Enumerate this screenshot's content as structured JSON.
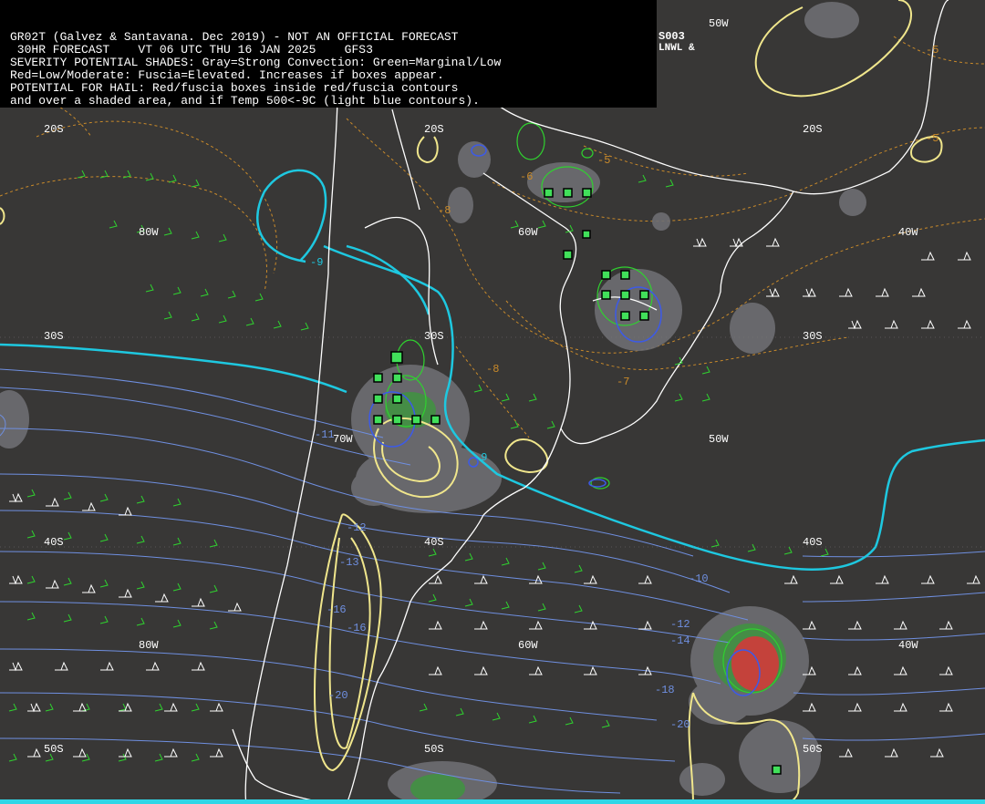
{
  "header": {
    "lines": [
      "GR02T (Galvez & Santavana. Dec 2019) - NOT AN OFFICIAL FORECAST",
      " 30HR FORECAST    VT 06 UTC THU 16 JAN 2025    GFS3",
      "SEVERITY POTENTIAL SHADES: Gray=Strong Convection: Green=Marginal/Low",
      "Red=Low/Moderate: Fuscia=Elevated. Increases if boxes appear.",
      "POTENTIAL FOR HAIL: Red/fuscia boxes inside red/fuscia contours",
      "and over a shaded area, and if Temp 500<-9C (light blue contours)."
    ],
    "corner_code": "S003",
    "corner_sub": "LNWL &"
  },
  "grid_labels": [
    {
      "text": "20S",
      "id": "lat-20s-a"
    },
    {
      "text": "20S",
      "id": "lat-20s-b"
    },
    {
      "text": "20S",
      "id": "lat-20s-c"
    },
    {
      "text": "30S",
      "id": "lat-30s-a"
    },
    {
      "text": "30S",
      "id": "lat-30s-b"
    },
    {
      "text": "30S",
      "id": "lat-30s-c"
    },
    {
      "text": "40S",
      "id": "lat-40s-a"
    },
    {
      "text": "40S",
      "id": "lat-40s-b"
    },
    {
      "text": "40S",
      "id": "lat-40s-c"
    },
    {
      "text": "50S",
      "id": "lat-50s-a"
    },
    {
      "text": "50S",
      "id": "lat-50s-b"
    },
    {
      "text": "50S",
      "id": "lat-50s-c"
    },
    {
      "text": "80W",
      "id": "lon-80w-a"
    },
    {
      "text": "80W",
      "id": "lon-80w-b"
    },
    {
      "text": "70W",
      "id": "lon-70w"
    },
    {
      "text": "60W",
      "id": "lon-60w-a"
    },
    {
      "text": "60W",
      "id": "lon-60w-b"
    },
    {
      "text": "50W",
      "id": "lon-50w-a"
    },
    {
      "text": "50W",
      "id": "lon-50w-b"
    },
    {
      "text": "40W",
      "id": "lon-40w-a"
    },
    {
      "text": "40W",
      "id": "lon-40w-b"
    }
  ],
  "temp_labels_orange": [
    "-5",
    "-6",
    "-7",
    "-8",
    "-8",
    "-5",
    "-5"
  ],
  "temp_labels_blue": [
    "-9",
    "-9",
    "-11",
    "-12",
    "-13",
    "-16",
    "-16",
    "-20",
    "-10",
    "-12",
    "-14",
    "-18",
    "-20"
  ],
  "colors": {
    "background": "#383736",
    "coast": "#ffffff",
    "cyan_contour": "#1ec8e0",
    "blue_isotherm": "#6f8fe0",
    "yellow_contour": "#f0e68c",
    "orange_dashed": "#c98a2a",
    "green_barb": "#2fd22f",
    "gray_shade": "#6e6e72",
    "red_shade": "#d23a3a",
    "green_box": "#41e05a"
  }
}
